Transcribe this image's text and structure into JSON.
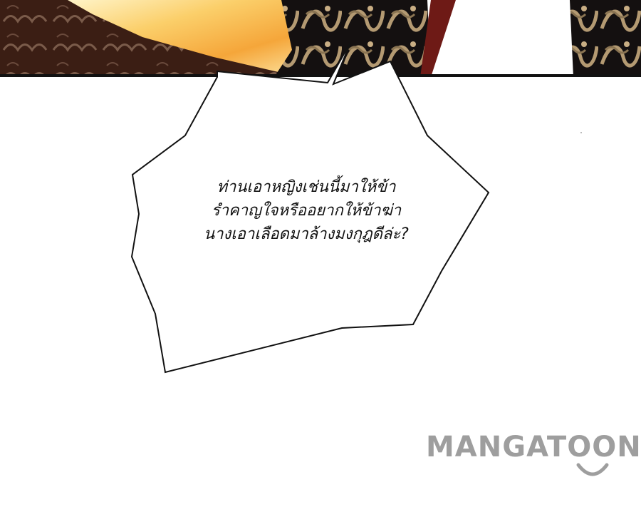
{
  "panel": {
    "dialogue": {
      "lines": [
        "ท่านเอาหญิงเช่นนี้มาให้ข้า",
        "รำคาญใจหรืออยากให้ข้าฆ่า",
        "นางเอาเลือดมาล้างมงกุฎดีล่ะ?"
      ]
    }
  },
  "watermark": {
    "text": "MANGATOON"
  },
  "colors": {
    "gold": "#f6b23e",
    "gold_light": "#fde7a6",
    "dark_robe": "#3b1e14",
    "black_robe": "#141010",
    "dragon": "#b49a72",
    "red_band": "#6e1a16",
    "watermark": "#9e9e9e"
  }
}
